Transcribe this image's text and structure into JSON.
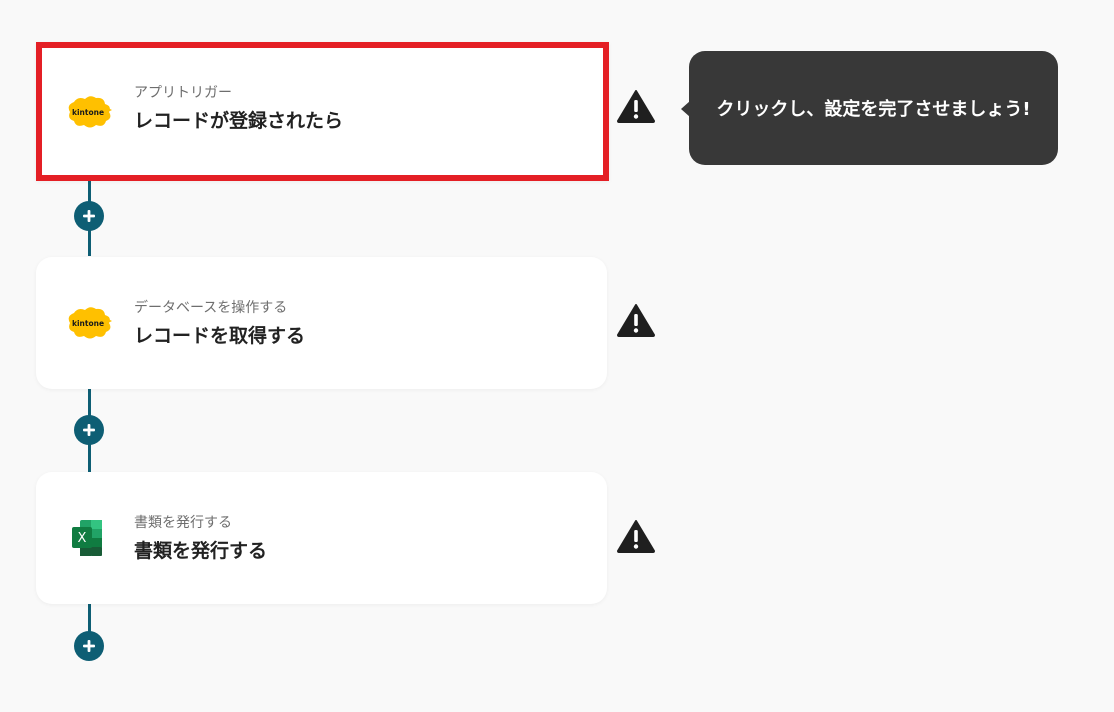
{
  "steps": [
    {
      "sub_label": "アプリトリガー",
      "main_label": "レコードが登録されたら",
      "app_icon": "kintone-icon",
      "highlighted": true,
      "status_icon": "warning-icon"
    },
    {
      "sub_label": "データベースを操作する",
      "main_label": "レコードを取得する",
      "app_icon": "kintone-icon",
      "highlighted": false,
      "status_icon": "warning-icon"
    },
    {
      "sub_label": "書類を発行する",
      "main_label": "書類を発行する",
      "app_icon": "excel-icon",
      "highlighted": false,
      "status_icon": "warning-icon"
    }
  ],
  "tooltip": {
    "text": "クリックし、設定を完了させましょう!"
  },
  "kintone_logo_text": "kintone",
  "excel_logo_text": "X",
  "colors": {
    "background": "#f9f9f9",
    "connector": "#0e5e74",
    "highlight_border": "#e41f25",
    "kintone_yellow": "#ffc000",
    "tooltip_bg": "#383838",
    "excel_green": "#107c41"
  }
}
